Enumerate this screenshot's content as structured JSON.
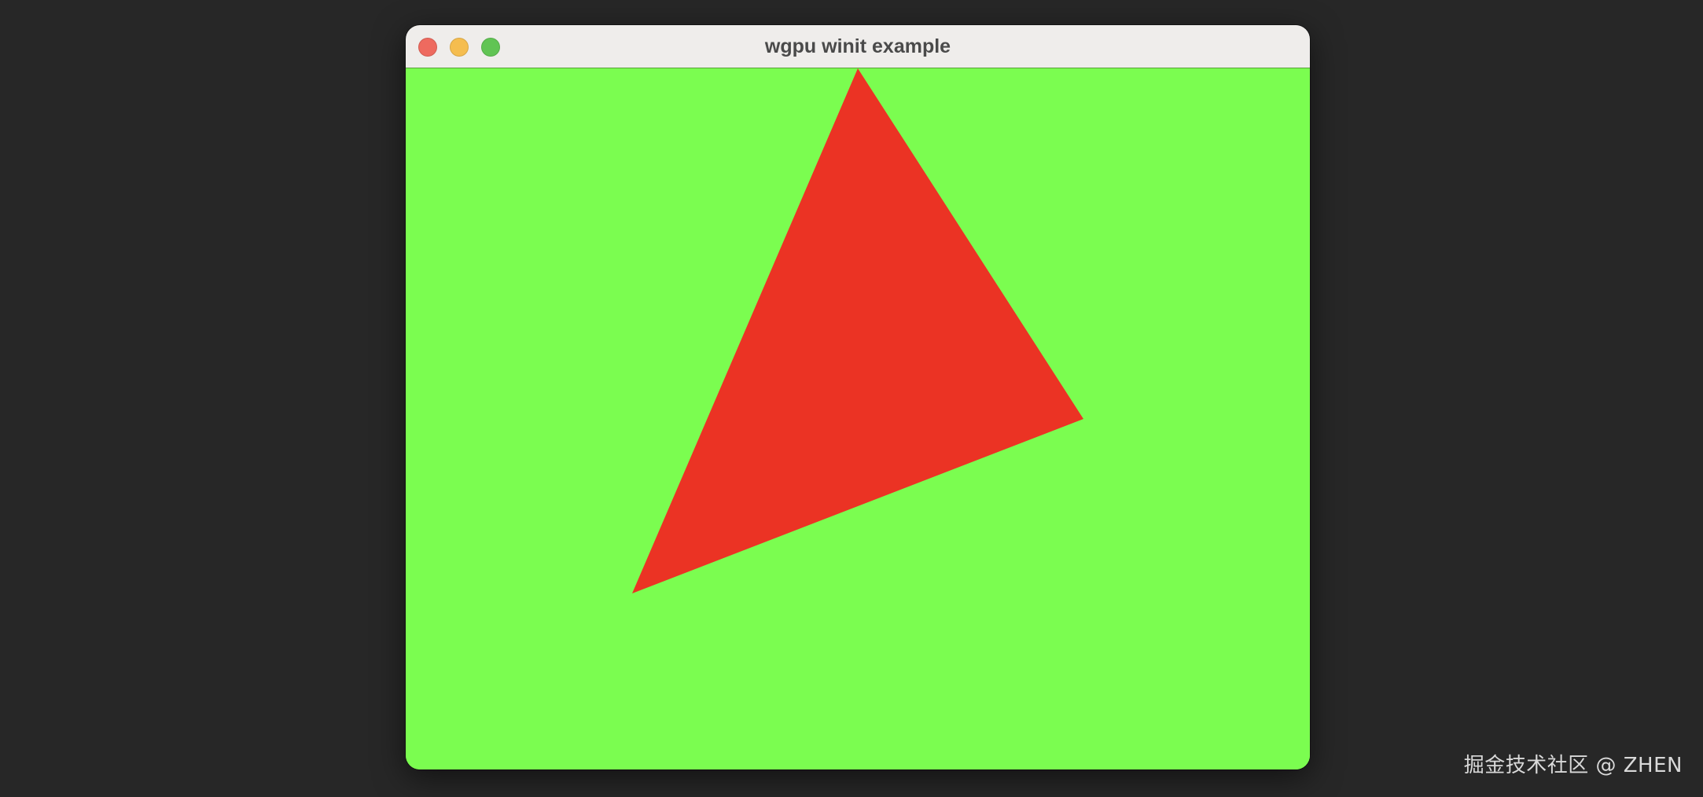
{
  "desktop": {
    "background_color": "#272727"
  },
  "window": {
    "title": "wgpu winit example",
    "titlebar_color": "#efedeb",
    "title_color": "#4a4a4a",
    "controls": [
      {
        "name": "close",
        "icon": "close-button-red-circle",
        "color": "#ee6a5f"
      },
      {
        "name": "minimize",
        "icon": "minimize-button-yellow-circle",
        "color": "#f5bd4f"
      },
      {
        "name": "zoom",
        "icon": "zoom-button-green-circle",
        "color": "#61c454"
      }
    ]
  },
  "canvas": {
    "clear_color": "#7bfd50",
    "triangle": {
      "shape": "triangle",
      "fill_color": "#eb3324"
    }
  },
  "watermark": {
    "text": "掘金技术社区 @ ZHEN",
    "color": "#d9d9d9"
  }
}
